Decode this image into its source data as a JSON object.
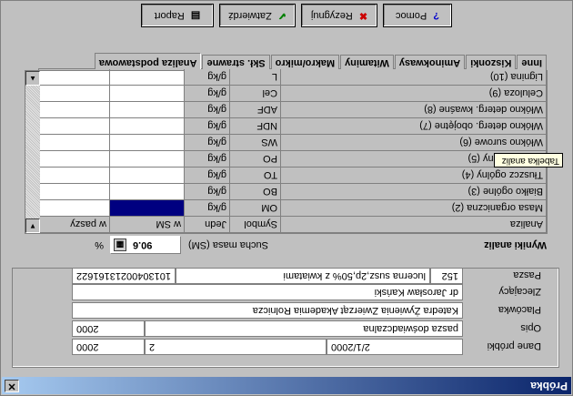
{
  "window": {
    "title": "Próbka",
    "close_glyph": "✕"
  },
  "sample": {
    "labels": {
      "dane": "Dane próbki",
      "opis": "Opis",
      "placowka": "Placówka",
      "zlecajacy": "Zlecający",
      "pasza": "Pasza"
    },
    "dane_fields": [
      "2/1/2000",
      "2",
      "2000"
    ],
    "opis_value": "pasza doświadczalna",
    "opis_year": "2000",
    "placowka_value": "Katedra Żywienia Zwierząt Akademia Rolnicza",
    "zlecajacy_value": "dr Jarosław Kański",
    "pasza_code": "152",
    "pasza_name": "lucerna susz,2p,50% z kwiatami",
    "pasza_number": "10130400213161622"
  },
  "results": {
    "title": "Wyniki analiz",
    "dry_mass_label": "Sucha masa (SM)",
    "dry_mass_value": "90.6",
    "dry_mass_unit": "%",
    "calc_icon": "▦"
  },
  "grid": {
    "headers": [
      "Analiza",
      "Symbol",
      "Jedn",
      "w SM",
      "w paszy"
    ],
    "rows": [
      {
        "name": "Masa organiczna   (2)",
        "symbol": "OM",
        "unit": "g/kg"
      },
      {
        "name": "Białko ogólne   (3)",
        "symbol": "BO",
        "unit": "g/kg"
      },
      {
        "name": "Tłuszcz ogólny   (4)",
        "symbol": "TO",
        "unit": "g/kg"
      },
      {
        "name": "Popiół ogólny   (5)",
        "symbol": "PO",
        "unit": "g/kg"
      },
      {
        "name": "Włókno surowe   (6)",
        "symbol": "WS",
        "unit": "g/kg"
      },
      {
        "name": "Włókno deterg. obojętne   (7)",
        "symbol": "NDF",
        "unit": "g/kg"
      },
      {
        "name": "Włókno deterg. kwaśne   (8)",
        "symbol": "ADF",
        "unit": "g/kg"
      },
      {
        "name": "Celuloza   (9)",
        "symbol": "Cel",
        "unit": "g/kg"
      },
      {
        "name": "Lignina   (10)",
        "symbol": "L",
        "unit": "g/kg"
      }
    ],
    "tooltip": "Tabelka analiz"
  },
  "tabs": [
    "Analiza podstawowa",
    "Skł. strawne",
    "Makro/mikro",
    "Witaminy",
    "Aminokwasy",
    "Kiszonki",
    "Inne"
  ],
  "buttons": {
    "raport": "Raport",
    "zatwierdz": "Zatwierdź",
    "rezygnuj": "Rezygnuj",
    "pomoc": "Pomoc",
    "raport_icon": "▤",
    "zatwierdz_icon": "✔",
    "rezygnuj_icon": "✖",
    "pomoc_icon": "?"
  },
  "colors": {
    "selected_cell": "#000080",
    "title_bar": "#0a246a",
    "cancel_icon": "#cc0000",
    "ok_icon": "#008000",
    "help_icon": "#0000cc"
  }
}
